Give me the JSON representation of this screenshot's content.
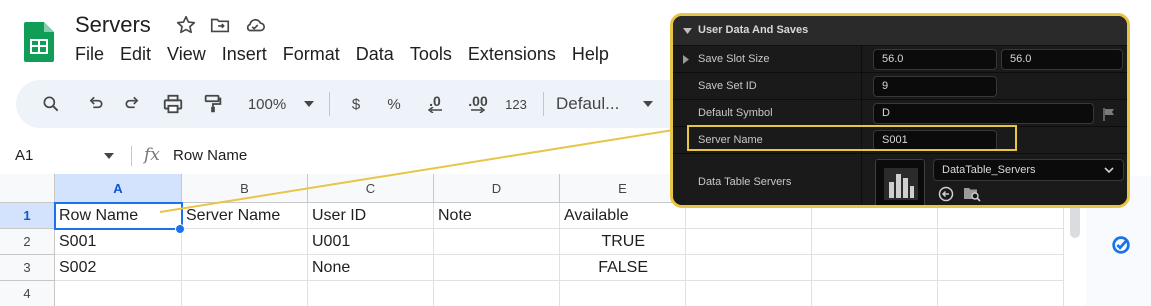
{
  "app": {
    "doc_title": "Servers",
    "menu": [
      "File",
      "Edit",
      "View",
      "Insert",
      "Format",
      "Data",
      "Tools",
      "Extensions",
      "Help"
    ],
    "title_icons": [
      "star-icon",
      "move-to-folder-icon",
      "cloud-status-icon"
    ]
  },
  "toolbar": {
    "icons": [
      "search-icon",
      "undo-icon",
      "redo-icon",
      "print-icon",
      "paint-format-icon"
    ],
    "zoom": "100%",
    "currency": "$",
    "percent": "%",
    "decrease_decimal": ".0",
    "increase_decimal": ".00",
    "number_format": "123",
    "font": "Defaul..."
  },
  "formula_bar": {
    "cell_ref": "A1",
    "fx": "fx",
    "value": "Row Name"
  },
  "grid": {
    "columns": [
      "A",
      "B",
      "C",
      "D",
      "E"
    ],
    "rows": [
      "1",
      "2",
      "3",
      "4"
    ],
    "cells": [
      [
        "Row Name",
        "Server Name",
        "User ID",
        "Note",
        "Available"
      ],
      [
        "S001",
        "",
        "U001",
        "",
        "TRUE"
      ],
      [
        "S002",
        "",
        "None",
        "",
        "FALSE"
      ],
      [
        "",
        "",
        "",
        "",
        ""
      ]
    ]
  },
  "details_panel": {
    "header": "User Data And Saves",
    "rows": {
      "save_slot_size": {
        "label": "Save Slot Size",
        "x": "56.0",
        "y": "56.0"
      },
      "save_set_id": {
        "label": "Save Set ID",
        "value": "9"
      },
      "default_symbol": {
        "label": "Default Symbol",
        "value": "D"
      },
      "server_name": {
        "label": "Server Name",
        "value": "S001"
      },
      "data_table": {
        "label": "Data Table Servers",
        "value": "DataTable_Servers"
      }
    },
    "accent_color": "#e8c547"
  },
  "colors": {
    "selection_blue": "#1a73e8",
    "header_selected": "#d3e3fd",
    "panel_bg": "#151515"
  }
}
